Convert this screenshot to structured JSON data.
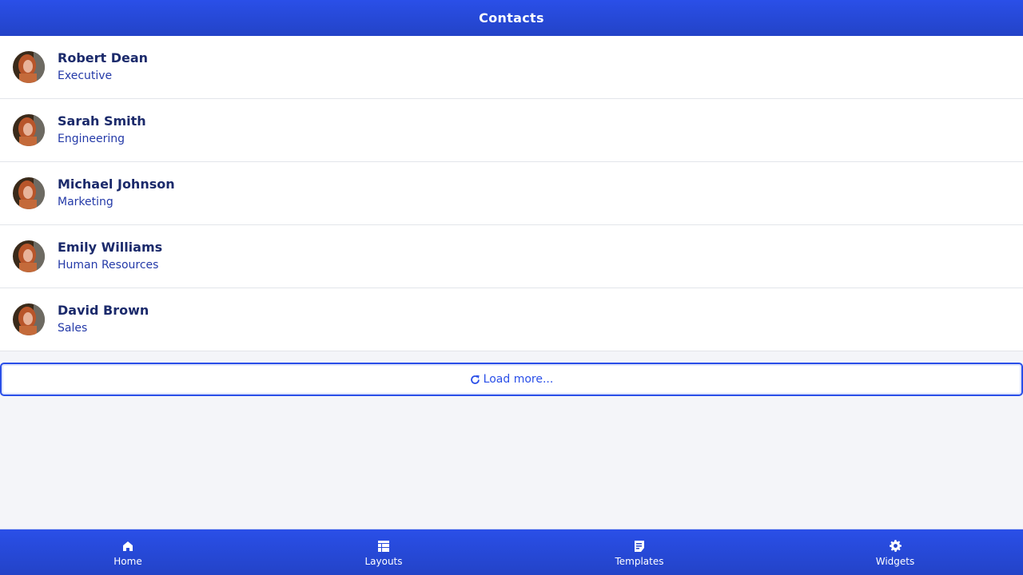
{
  "header": {
    "title": "Contacts"
  },
  "contacts": [
    {
      "name": "Robert Dean",
      "role": "Executive"
    },
    {
      "name": "Sarah Smith",
      "role": "Engineering"
    },
    {
      "name": "Michael Johnson",
      "role": "Marketing"
    },
    {
      "name": "Emily Williams",
      "role": "Human Resources"
    },
    {
      "name": "David Brown",
      "role": "Sales"
    }
  ],
  "load_more": {
    "label": "Load more...",
    "icon": "refresh-icon"
  },
  "bottom_nav": [
    {
      "label": "Home",
      "icon": "home-icon"
    },
    {
      "label": "Layouts",
      "icon": "table-icon"
    },
    {
      "label": "Templates",
      "icon": "document-icon"
    },
    {
      "label": "Widgets",
      "icon": "gear-icon"
    }
  ],
  "colors": {
    "primary": "#2a4fe8",
    "primary_dark": "#2343c7",
    "text_dark": "#1b2a6b",
    "background": "#f4f5f9"
  }
}
